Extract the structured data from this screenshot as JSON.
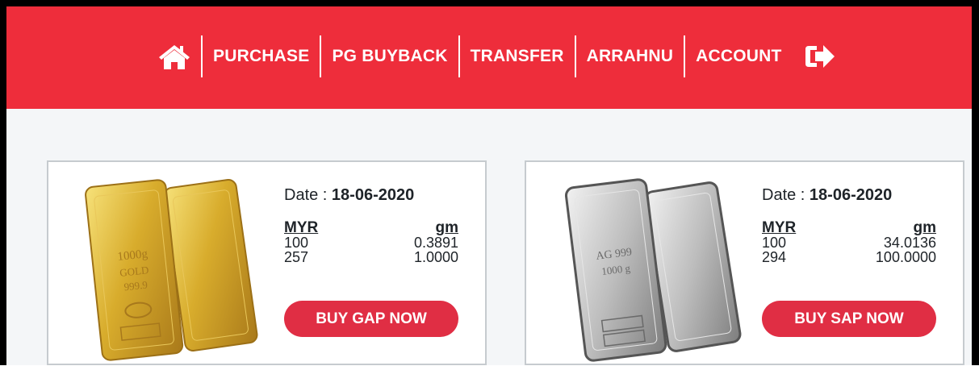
{
  "nav": {
    "home_icon": "home-icon",
    "items": [
      "PURCHASE",
      "PG BUYBACK",
      "TRANSFER",
      "ARRAHNU",
      "ACCOUNT"
    ],
    "logout_icon": "sign-out-icon"
  },
  "colors": {
    "brand_red": "#ee2d3b",
    "button_red": "#e02e44"
  },
  "products": [
    {
      "metal": "gold",
      "image": "gold-bars-image",
      "date_label": "Date :",
      "date": "18-06-2020",
      "col_currency": "MYR",
      "col_unit": "gm",
      "rows": [
        {
          "myr": "100",
          "gm": "0.3891"
        },
        {
          "myr": "257",
          "gm": "1.0000"
        }
      ],
      "button": "BUY GAP NOW"
    },
    {
      "metal": "silver",
      "image": "silver-bars-image",
      "date_label": "Date :",
      "date": "18-06-2020",
      "col_currency": "MYR",
      "col_unit": "gm",
      "rows": [
        {
          "myr": "100",
          "gm": "34.0136"
        },
        {
          "myr": "294",
          "gm": "100.0000"
        }
      ],
      "button": "BUY SAP NOW"
    }
  ]
}
